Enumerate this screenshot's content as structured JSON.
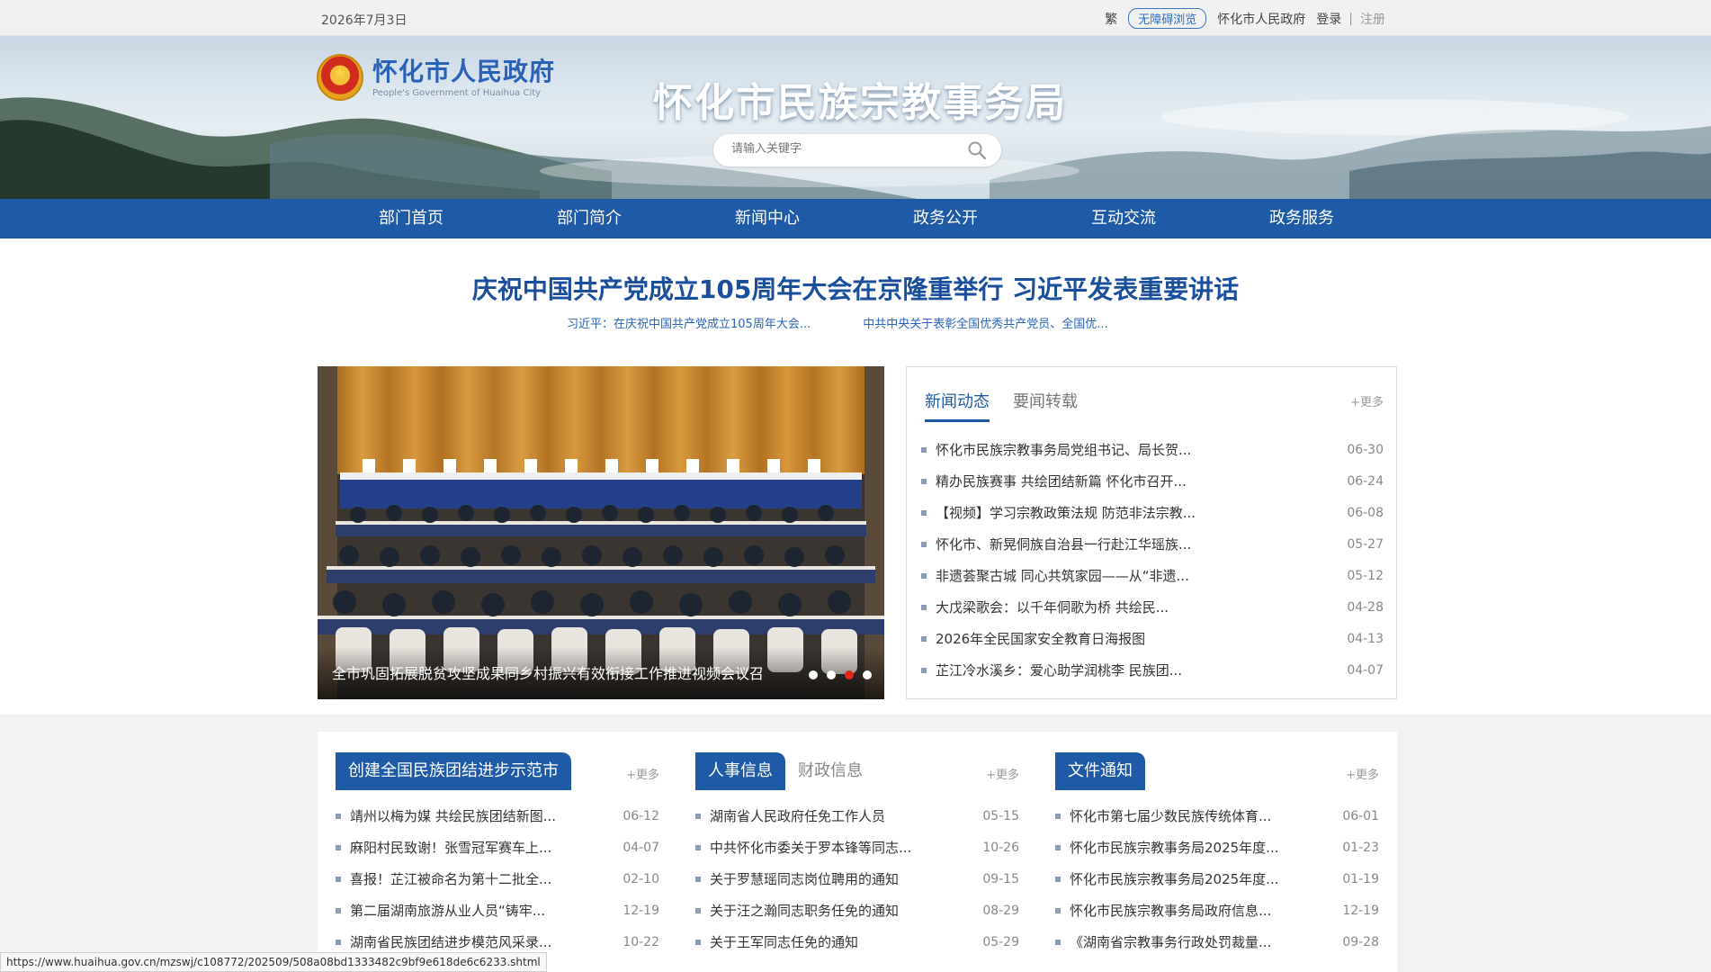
{
  "topbar": {
    "date": "2026年7月3日",
    "traditional": "繁",
    "accessibility": "无障碍浏览",
    "gov_link": "怀化市人民政府",
    "login": "登录",
    "separator": "|",
    "register": "注册"
  },
  "header": {
    "logo_cn": "怀化市人民政府",
    "logo_en": "People's Government of Huaihua City",
    "site_title": "怀化市民族宗教事务局",
    "search_placeholder": "请输入关键字"
  },
  "nav": [
    "部门首页",
    "部门简介",
    "新闻中心",
    "政务公开",
    "互动交流",
    "政务服务"
  ],
  "headline": {
    "title": "庆祝中国共产党成立105周年大会在京隆重举行 习近平发表重要讲话",
    "links": [
      "习近平：在庆祝中国共产党成立105周年大会...",
      "中共中央关于表彰全国优秀共产党员、全国优..."
    ]
  },
  "slideshow": {
    "caption": "全市巩固拓展脱贫攻坚成果同乡村振兴有效衔接工作推进视频会议召",
    "dots": 4,
    "active_dot": 3
  },
  "news_panel": {
    "tabs": [
      "新闻动态",
      "要闻转载"
    ],
    "more": "+更多",
    "items": [
      {
        "title": "怀化市民族宗教事务局党组书记、局长贺...",
        "date": "06-30"
      },
      {
        "title": "精办民族赛事 共绘团结新篇 怀化市召开...",
        "date": "06-24"
      },
      {
        "title": "【视频】学习宗教政策法规 防范非法宗教...",
        "date": "06-08"
      },
      {
        "title": "怀化市、新晃侗族自治县一行赴江华瑶族...",
        "date": "05-27"
      },
      {
        "title": "非遗荟聚古城 同心共筑家园——从“非遗...",
        "date": "05-12"
      },
      {
        "title": "大戊梁歌会：以千年侗歌为桥 共绘民...",
        "date": "04-28"
      },
      {
        "title": "2026年全民国家安全教育日海报图",
        "date": "04-13"
      },
      {
        "title": "芷江冷水溪乡：爱心助学润桃李 民族团...",
        "date": "04-07"
      }
    ]
  },
  "columns": [
    {
      "tab": "创建全国民族团结进步示范市",
      "tab2": "",
      "more": "+更多",
      "items": [
        {
          "title": "靖州以梅为媒 共绘民族团结新图...",
          "date": "06-12"
        },
        {
          "title": "麻阳村民致谢！张雪冠军赛车上...",
          "date": "04-07"
        },
        {
          "title": "喜报！芷江被命名为第十二批全...",
          "date": "02-10"
        },
        {
          "title": "第二届湖南旅游从业人员“铸牢...",
          "date": "12-19"
        },
        {
          "title": "湖南省民族团结进步模范风采录...",
          "date": "10-22"
        }
      ]
    },
    {
      "tab": "人事信息",
      "tab2": "财政信息",
      "more": "+更多",
      "items": [
        {
          "title": "湖南省人民政府任免工作人员",
          "date": "05-15"
        },
        {
          "title": "中共怀化市委关于罗本锋等同志...",
          "date": "10-26"
        },
        {
          "title": "关于罗慧瑶同志岗位聘用的通知",
          "date": "09-15"
        },
        {
          "title": "关于汪之瀚同志职务任免的通知",
          "date": "08-29"
        },
        {
          "title": "关于王军同志任免的通知",
          "date": "05-29"
        }
      ]
    },
    {
      "tab": "文件通知",
      "tab2": "",
      "more": "+更多",
      "items": [
        {
          "title": "怀化市第七届少数民族传统体育...",
          "date": "06-01"
        },
        {
          "title": "怀化市民族宗教事务局2025年度...",
          "date": "01-23"
        },
        {
          "title": "怀化市民族宗教事务局2025年度...",
          "date": "01-19"
        },
        {
          "title": "怀化市民族宗教事务局政府信息...",
          "date": "12-19"
        },
        {
          "title": "《湖南省宗教事务行政处罚裁量...",
          "date": "09-28"
        }
      ]
    }
  ],
  "statusbar": "https://www.huaihua.gov.cn/mzswj/c108772/202509/508a08bd1333482c9bf9e618de6c6233.shtml"
}
